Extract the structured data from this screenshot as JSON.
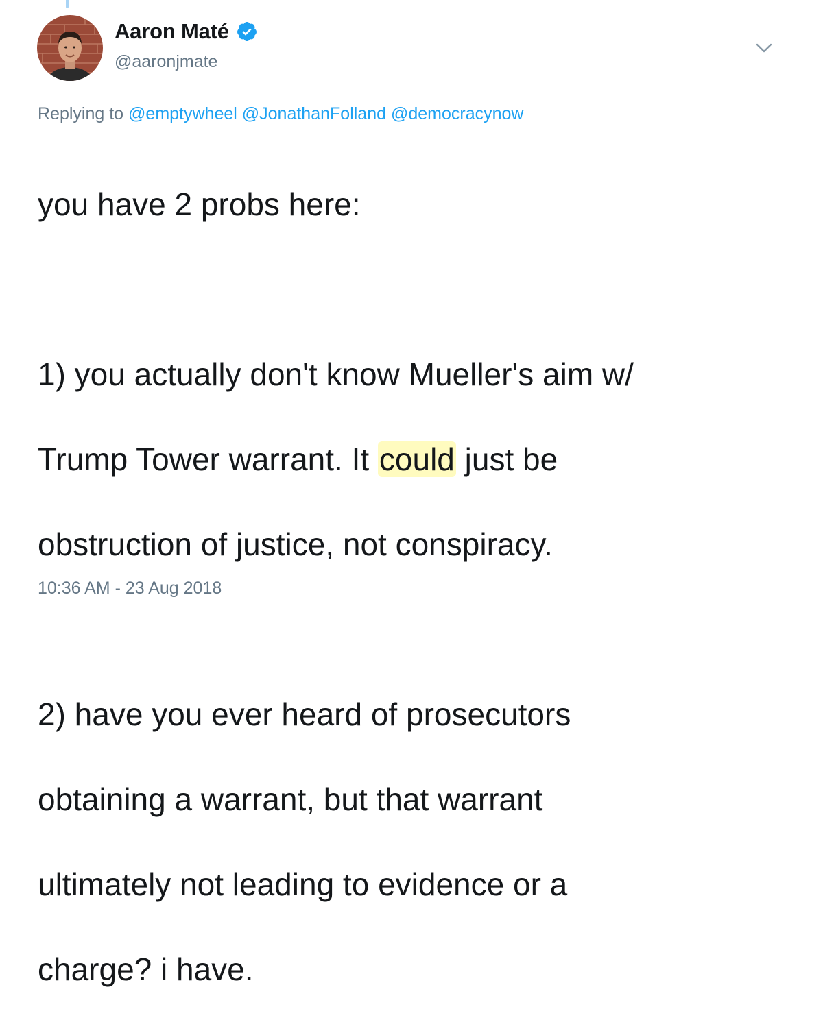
{
  "author": {
    "display_name": "Aaron Maté",
    "handle": "@aaronjmate",
    "verified": true,
    "verified_color": "#1da1f2"
  },
  "reply": {
    "prefix": "Replying to",
    "mentions": [
      "@emptywheel",
      "@JonathanFolland",
      "@democracynow"
    ]
  },
  "tweet": {
    "line1": "you have 2 probs here:",
    "p2_line1": "1) you actually don't know Mueller's aim w/",
    "p2_line2_before": "Trump Tower warrant. It ",
    "p2_line2_highlight": "could",
    "p2_line2_after": " just be",
    "p2_line3": "obstruction of justice, not conspiracy.",
    "p3_line1": "2) have you ever heard of prosecutors",
    "p3_line2": "obtaining a warrant, but that warrant",
    "p3_line3": "ultimately not leading to evidence or a",
    "p3_line4": "charge? i have.",
    "highlight_color": "#fffbbf"
  },
  "timestamp": "10:36 AM - 23 Aug 2018",
  "icons": {
    "verified": "verified-badge-icon",
    "caret": "chevron-down-icon"
  },
  "colors": {
    "link": "#1da1f2",
    "secondary_text": "#657786",
    "primary_text": "#14171a"
  }
}
